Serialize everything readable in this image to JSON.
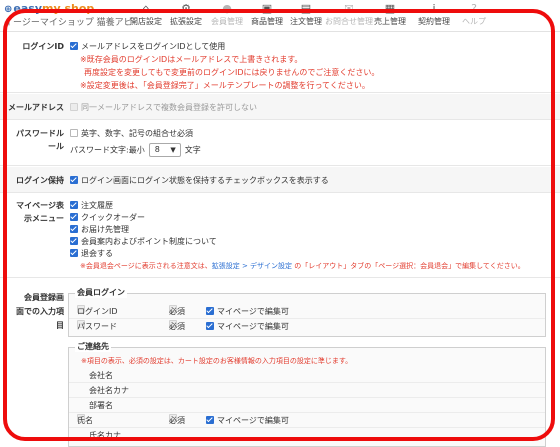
{
  "header": {
    "logo_text_a": "easy",
    "logo_text_b": "my shop",
    "subtitle": "イージーマイショップ 猫養アビ",
    "nav": [
      {
        "label": "開店設定",
        "icon": "home-icon",
        "dim": false
      },
      {
        "label": "拡張設定",
        "icon": "gear-icon",
        "dim": false
      },
      {
        "label": "会員管理",
        "icon": "user-icon",
        "dim": true
      },
      {
        "label": "商品管理",
        "icon": "gift-icon",
        "dim": false
      },
      {
        "label": "注文管理",
        "icon": "document-icon",
        "dim": false
      },
      {
        "label": "お問合せ管理",
        "icon": "mail-icon",
        "dim": true
      },
      {
        "label": "売上管理",
        "icon": "calculator-icon",
        "dim": false
      },
      {
        "label": "契約管理",
        "icon": "info-icon",
        "dim": false
      },
      {
        "label": "ヘルプ",
        "icon": "help-icon",
        "dim": true
      }
    ]
  },
  "login_id": {
    "label": "ログインID",
    "option": "メールアドレスをログインIDとして使用",
    "note1": "※既存会員のログインIDはメールアドレスで上書きされます。",
    "note2": "再度設定を変更してもで変更前のログインIDには戻りませんのでご注意ください。",
    "note3": "※設定変更後は、「会員登録完了」メールテンプレートの調整を行ってください。"
  },
  "mail": {
    "label": "メールアドレス",
    "option": "同一メールアドレスで複数会員登録を許可しない"
  },
  "password": {
    "label_a": "パスワードル",
    "label_b": "ール",
    "option": "英字、数字、記号の組合せ必須",
    "minlen_label": "パスワード文字:最小",
    "minlen_value": "8",
    "minlen_unit": "文字"
  },
  "keep_login": {
    "label": "ログイン保持",
    "option": "ログイン画面にログイン状態を保持するチェックボックスを表示する"
  },
  "mypage": {
    "label_a": "マイページ表",
    "label_b": "示メニュー",
    "items": [
      "注文履歴",
      "クイックオーダー",
      "お届け先管理",
      "会員案内およびポイント制度について",
      "退会する"
    ],
    "note_a": "※会員退会ページに表示される注意文は、",
    "note_link1": "拡張設定 > デザイン設定",
    "note_b": " の「レイアウト」タブの「ページ選択：会員退会」で編集してください。"
  },
  "register": {
    "label_a": "会員登録画",
    "label_b": "面での入力項",
    "label_c": "目",
    "login_group": {
      "title": "会員ログイン",
      "rows": [
        {
          "name": "ログインID",
          "req": "必須",
          "edit": "マイページで編集可"
        },
        {
          "name": "パスワード",
          "req": "必須",
          "edit": "マイページで編集可"
        }
      ]
    },
    "contact_group": {
      "title": "ご連絡先",
      "note": "※項目の表示、必須の設定は、カート設定のお客様情報の入力項目の設定に準じます。",
      "rows": [
        {
          "name": "会社名"
        },
        {
          "name": "会社名カナ"
        },
        {
          "name": "部署名"
        },
        {
          "name": "氏名",
          "req": "必須",
          "edit": "マイページで編集可"
        },
        {
          "name": "氏名カナ"
        }
      ]
    }
  }
}
